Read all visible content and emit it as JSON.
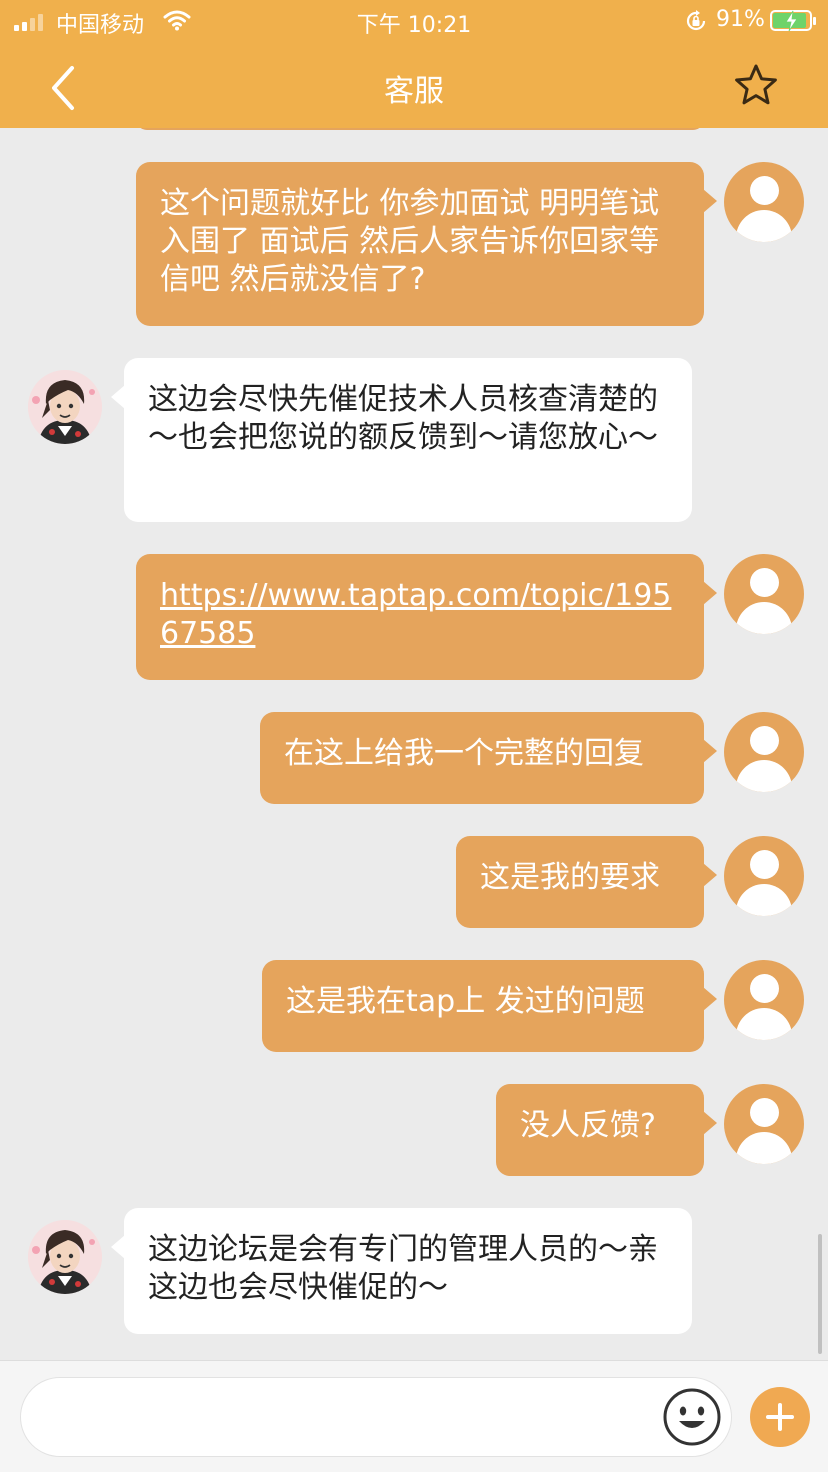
{
  "status_bar": {
    "carrier": "中国移动",
    "time": "下午 10:21",
    "battery_percent": "91%",
    "battery_level": 0.91,
    "icons": [
      "signal-icon",
      "wifi-icon",
      "orientation-lock-icon",
      "battery-charging-icon"
    ]
  },
  "nav": {
    "title": "客服",
    "back_icon": "chevron-left-icon",
    "favorite_icon": "star-outline-icon"
  },
  "messages": [
    {
      "from": "user",
      "text": "这个问题就好比 你参加面试 明明笔试入围了 面试后 然后人家告诉你回家等信吧 然后就没信了?"
    },
    {
      "from": "agent",
      "text": "这边会尽快先催促技术人员核查清楚的～也会把您说的额反馈到～请您放心～"
    },
    {
      "from": "user",
      "text": "https://www.taptap.com/topic/19567585",
      "is_link": true
    },
    {
      "from": "user",
      "text": "在这上给我一个完整的回复"
    },
    {
      "from": "user",
      "text": "这是我的要求"
    },
    {
      "from": "user",
      "text": "这是我在tap上 发过的问题"
    },
    {
      "from": "user",
      "text": "没人反馈?"
    },
    {
      "from": "agent",
      "text": "这边论坛是会有专门的管理人员的～亲这边也会尽快催促的～"
    }
  ],
  "input": {
    "value": "",
    "placeholder": "",
    "emoji_icon": "emoji-smile-icon",
    "add_icon": "plus-circle-icon"
  },
  "colors": {
    "header": "#f0b04c",
    "user_bubble": "#e5a45c",
    "agent_bubble": "#ffffff",
    "background": "#ebebeb",
    "plus_button": "#f0a952"
  }
}
